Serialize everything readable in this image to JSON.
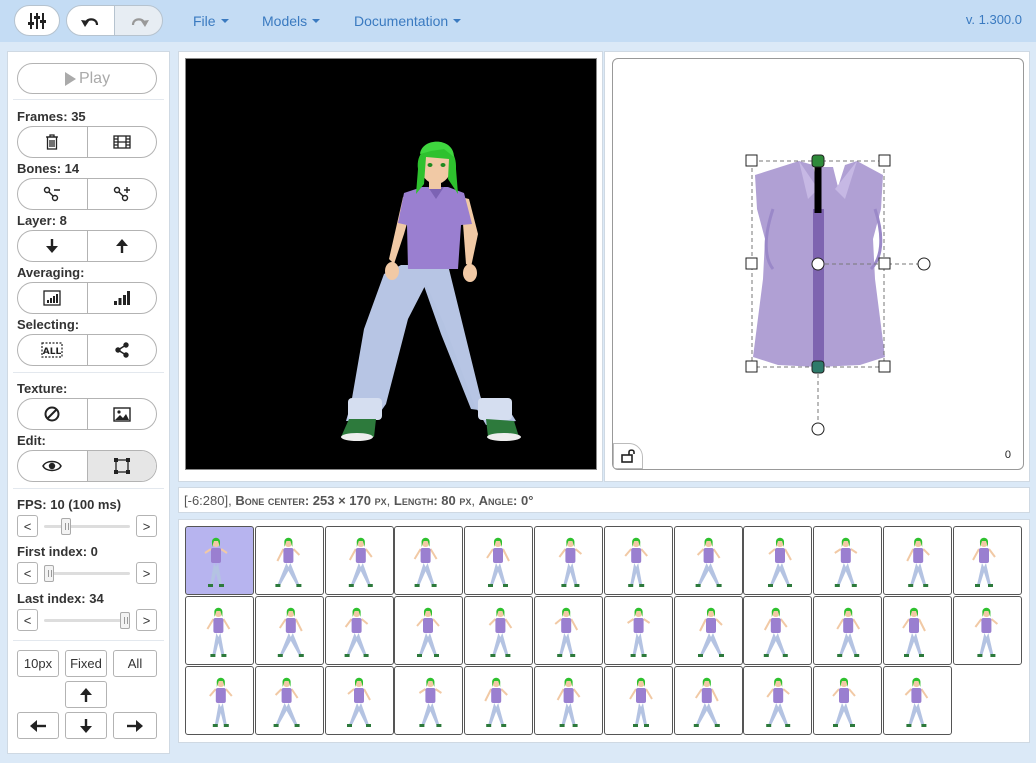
{
  "app": {
    "version": "v. 1.300.0"
  },
  "menu": {
    "file": "File",
    "models": "Models",
    "documentation": "Documentation"
  },
  "controls": {
    "play": "Play",
    "frames_label": "Frames: 35",
    "bones_label": "Bones: 14",
    "layer_label": "Layer: 8",
    "averaging_label": "Averaging:",
    "selecting_label": "Selecting:",
    "texture_label": "Texture:",
    "edit_label": "Edit:",
    "fps_label": "FPS: 10 (100 ms)",
    "first_index_label": "First index: 0",
    "last_index_label": "Last index: 34",
    "dec": "<",
    "inc": ">",
    "step_10px": "10px",
    "fixed": "Fixed",
    "all": "All",
    "sliders": {
      "fps": 0.23,
      "first": 0.0,
      "last": 1.0
    }
  },
  "status": {
    "coords": "[-6:280],",
    "bone_center_label": "Bone center:",
    "bone_center_value": "253 × 170",
    "px1": "px",
    "sep1": ",",
    "length_label": "Length:",
    "length_value": "80",
    "px2": "px",
    "sep2": ",",
    "angle_label": "Angle:",
    "angle_value": "0°"
  },
  "editor": {
    "counter": "0"
  },
  "frames": {
    "count": 35,
    "selected": 0
  },
  "colors": {
    "accent": "#3a7ac0",
    "shirt": "#9a7fd0",
    "hair": "#2ec12e",
    "jeans": "#b4c3e2",
    "selected_frame": "#b7b4ef"
  }
}
